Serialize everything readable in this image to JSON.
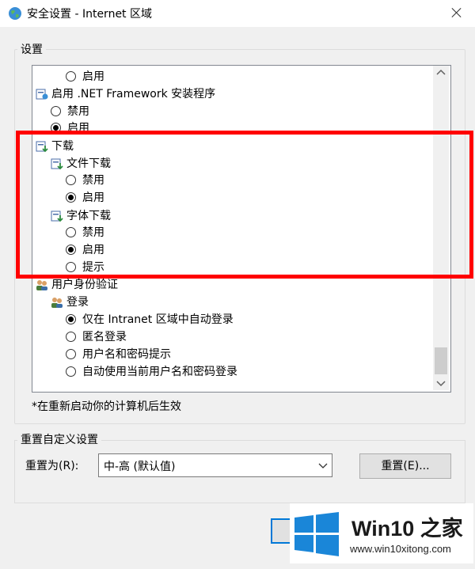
{
  "window": {
    "title": "安全设置 - Internet 区域"
  },
  "settings": {
    "group_label": "设置",
    "items": [
      {
        "kind": "option",
        "label": "启用",
        "checked": false
      },
      {
        "kind": "category",
        "label": "启用 .NET Framework 安装程序",
        "icon": "settings-category-icon"
      },
      {
        "kind": "option",
        "label": "禁用",
        "checked": false
      },
      {
        "kind": "option",
        "label": "启用",
        "checked": true
      },
      {
        "kind": "category",
        "label": "下载",
        "icon": "download-category-icon"
      },
      {
        "kind": "subcategory",
        "label": "文件下载",
        "icon": "download-category-icon"
      },
      {
        "kind": "option",
        "label": "禁用",
        "checked": false
      },
      {
        "kind": "option",
        "label": "启用",
        "checked": true
      },
      {
        "kind": "subcategory",
        "label": "字体下载",
        "icon": "download-category-icon"
      },
      {
        "kind": "option",
        "label": "禁用",
        "checked": false
      },
      {
        "kind": "option",
        "label": "启用",
        "checked": true
      },
      {
        "kind": "option",
        "label": "提示",
        "checked": false
      },
      {
        "kind": "category",
        "label": "用户身份验证",
        "icon": "users-category-icon"
      },
      {
        "kind": "subcategory",
        "label": "登录",
        "icon": "users-category-icon"
      },
      {
        "kind": "option",
        "label": "仅在 Intranet 区域中自动登录",
        "checked": true
      },
      {
        "kind": "option",
        "label": "匿名登录",
        "checked": false
      },
      {
        "kind": "option",
        "label": "用户名和密码提示",
        "checked": false
      },
      {
        "kind": "option",
        "label": "自动使用当前用户名和密码登录",
        "checked": false
      }
    ],
    "note": "*在重新启动你的计算机后生效"
  },
  "reset": {
    "group_label": "重置自定义设置",
    "label": "重置为(R):",
    "selected": "中-高 (默认值)",
    "button": "重置(E)..."
  },
  "watermark": {
    "brand": "Win10 之家",
    "url": "www.win10xitong.com"
  },
  "colors": {
    "highlight_box": "#ff0000",
    "windows_blue": "#1a86d8"
  }
}
